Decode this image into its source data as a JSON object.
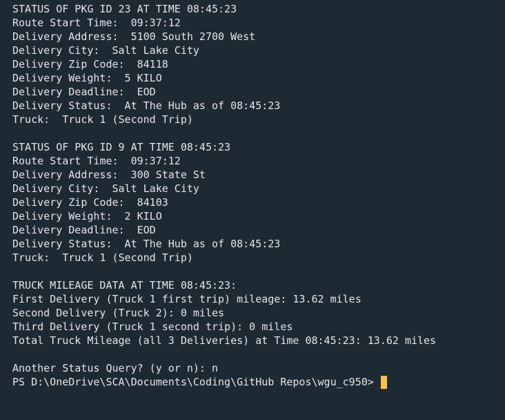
{
  "colors": {
    "background": "#1e2a33",
    "text": "#e6e6e6",
    "cursor": "#f2c04e"
  },
  "terminal": {
    "lines": [
      "STATUS OF PKG ID 23 AT TIME 08:45:23",
      "Route Start Time:  09:37:12",
      "Delivery Address:  5100 South 2700 West",
      "Delivery City:  Salt Lake City",
      "Delivery Zip Code:  84118",
      "Delivery Weight:  5 KILO",
      "Delivery Deadline:  EOD",
      "Delivery Status:  At The Hub as of 08:45:23",
      "Truck:  Truck 1 (Second Trip)",
      "",
      "STATUS OF PKG ID 9 AT TIME 08:45:23",
      "Route Start Time:  09:37:12",
      "Delivery Address:  300 State St",
      "Delivery City:  Salt Lake City",
      "Delivery Zip Code:  84103",
      "Delivery Weight:  2 KILO",
      "Delivery Deadline:  EOD",
      "Delivery Status:  At The Hub as of 08:45:23",
      "Truck:  Truck 1 (Second Trip)",
      "",
      "TRUCK MILEAGE DATA AT TIME 08:45:23:",
      "First Delivery (Truck 1 first trip) mileage: 13.62 miles",
      "Second Delivery (Truck 2): 0 miles",
      "Third Delivery (Truck 1 second trip): 0 miles",
      "Total Truck Mileage (all 3 Deliveries) at Time 08:45:23: 13.62 miles",
      "",
      "Another Status Query? (y or n): n"
    ],
    "prompt": "PS D:\\OneDrive\\SCA\\Documents\\Coding\\GitHub Repos\\wgu_c950> "
  }
}
